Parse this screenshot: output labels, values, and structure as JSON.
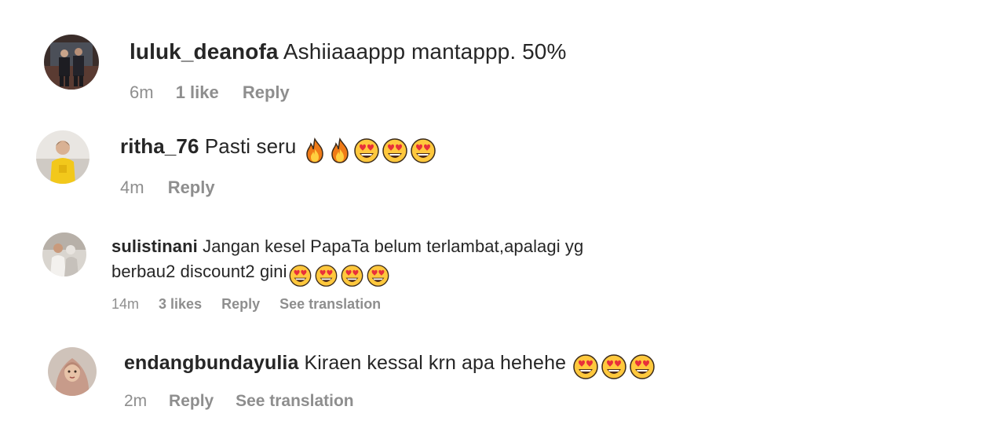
{
  "comments": [
    {
      "username": "luluk_deanofa",
      "text": "Ashiiaaappp mantappp. 50%",
      "time": "6m",
      "likes": "1 like",
      "reply": "Reply",
      "emojis": []
    },
    {
      "username": "ritha_76",
      "text": "Pasti seru",
      "time": "4m",
      "reply": "Reply",
      "emojis": [
        "fire",
        "fire",
        "heart-eyes",
        "heart-eyes",
        "heart-eyes"
      ]
    },
    {
      "username": "sulistinani",
      "text": "Jangan kesel PapaTa belum terlambat,apalagi yg",
      "text_line2": "berbau2 discount2 gini",
      "time": "14m",
      "likes": "3 likes",
      "reply": "Reply",
      "translate": "See translation",
      "emojis": [
        "heart-eyes",
        "heart-eyes",
        "heart-eyes",
        "heart-eyes"
      ]
    },
    {
      "username": "endangbundayulia",
      "text": "Kiraen kessal krn apa hehehe",
      "time": "2m",
      "reply": "Reply",
      "translate": "See translation",
      "emojis": [
        "heart-eyes",
        "heart-eyes",
        "heart-eyes"
      ]
    }
  ],
  "colors": {
    "text": "#262626",
    "meta": "#8e8e8e",
    "background": "#ffffff"
  }
}
